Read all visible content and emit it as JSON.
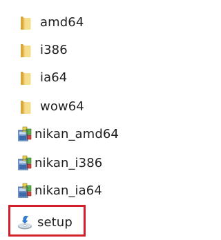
{
  "files": [
    {
      "name": "amd64",
      "type": "folder",
      "icon": "folder-icon"
    },
    {
      "name": "i386",
      "type": "folder",
      "icon": "folder-icon"
    },
    {
      "name": "ia64",
      "type": "folder",
      "icon": "folder-icon"
    },
    {
      "name": "wow64",
      "type": "folder",
      "icon": "folder-icon"
    },
    {
      "name": "nikan_amd64",
      "type": "installer",
      "icon": "installer-package-icon"
    },
    {
      "name": "nikan_i386",
      "type": "installer",
      "icon": "installer-package-icon"
    },
    {
      "name": "nikan_ia64",
      "type": "installer",
      "icon": "installer-package-icon"
    },
    {
      "name": "setup",
      "type": "setup",
      "icon": "setup-icon"
    }
  ],
  "highlight": {
    "target": "setup",
    "color": "#d21f2c"
  },
  "colors": {
    "folder_light": "#f6dd8e",
    "folder_dark": "#d9a63c",
    "text": "#1e1e1e"
  }
}
